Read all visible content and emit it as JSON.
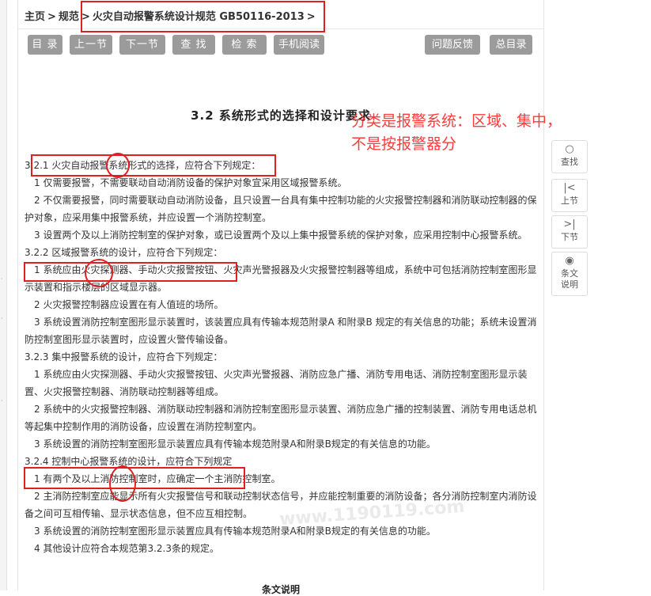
{
  "breadcrumb": {
    "home": "主页",
    "sep1": ">",
    "category": "规范",
    "sep2": ">",
    "current": "火灾自动报警系统设计规范 GB50116-2013",
    "sep3": ">"
  },
  "toolbar": {
    "contents": "目 录",
    "prev": "上一节",
    "next": "下一节",
    "find": "查 找",
    "search": "检 索",
    "mobile": "手机阅读",
    "feedback": "问题反馈",
    "master_contents": "总目录"
  },
  "page_title": "3.2 系统形式的选择和设计要求",
  "annotation": {
    "line1": "分类是报警系统：区域、集中，",
    "line2": "不是按报警器分",
    "color": "#ff3b3b"
  },
  "side_tools": {
    "find": "查找",
    "prev": "上节",
    "next": "下节",
    "notes": "条文说明"
  },
  "content": {
    "s321_head": "3.2.1 火灾自动报警系统形式的选择，应符合下列规定：",
    "s321_1": "1 仅需要报警，不需要联动自动消防设备的保护对象宜采用区域报警系统。",
    "s321_2": "2 不仅需要报警，同时需要联动自动消防设备，且只设置一台具有集中控制功能的火灾报警控制器和消防联动控制器的保护对象，应采用集中报警系统，并应设置一个消防控制室。",
    "s321_3": "3 设置两个及以上消防控制室的保护对象，或已设置两个及以上集中报警系统的保护对象，应采用控制中心报警系统。",
    "s322_head": "3.2.2 区域报警系统的设计，应符合下列规定：",
    "s322_1": "1 系统应由火灾探测器、手动火灾报警按钮、火灾声光警报器及火灾报警控制器等组成，系统中可包括消防控制室图形显示装置和指示楼层的区域显示器。",
    "s322_2": "2 火灾报警控制器应设置在有人值班的场所。",
    "s322_3": "3 系统设置消防控制室图形显示装置时，该装置应具有传输本规范附录A 和附录B 规定的有关信息的功能；系统未设置消防控制室图形显示装置时，应设置火警传输设备。",
    "s323_head": "3.2.3 集中报警系统的设计，应符合下列规定：",
    "s323_1": "1 系统应由火灾探测器、手动火灾报警按钮、火灾声光警报器、消防应急广播、消防专用电话、消防控制室图形显示装置、火灾报警控制器、消防联动控制器等组成。",
    "s323_2": "2 系统中的火灾报警控制器、消防联动控制器和消防控制室图形显示装置、消防应急广播的控制装置、消防专用电话总机等起集中控制作用的消防设备，应设置在消防控制室内。",
    "s323_3": "3 系统设置的消防控制室图形显示装置应具有传输本规范附录A和附录B规定的有关信息的功能。",
    "s324_head": "3.2.4 控制中心报警系统的设计，应符合下列规定",
    "s324_1": "1 有两个及以上消防控制室时，应确定一个主消防控制室。",
    "s324_2": "2 主消防控制室应能显示所有火灾报警信号和联动控制状态信号，并应能控制重要的消防设备；各分消防控制室内消防设备之间可互相传输、显示状态信息，但不应互相控制。",
    "s324_3": "3 系统设置的消防控制室图形显示装置应具有传输本规范附录A和附录B规定的有关信息的功能。",
    "s324_4": "4 其他设计应符合本规范第3.2.3条的规定。",
    "next_section": "条文说明"
  },
  "watermark": "www.1190119.com"
}
